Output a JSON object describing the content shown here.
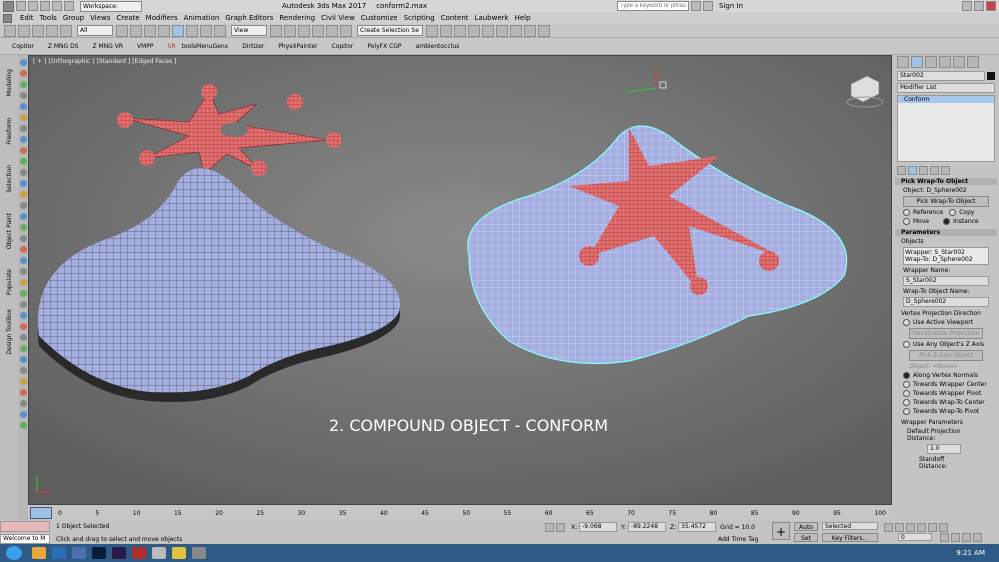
{
  "titlebar": {
    "workspace": "Workspace: Default",
    "app_title": "Autodesk 3ds Max 2017",
    "file_name": "conform2.max",
    "search_placeholder": "Type a keyword or phrase",
    "sign_in": "Sign In"
  },
  "menu": [
    "Edit",
    "Tools",
    "Group",
    "Views",
    "Create",
    "Modifiers",
    "Animation",
    "Graph Editors",
    "Rendering",
    "Civil View",
    "Customize",
    "Scripting",
    "Content",
    "Laubwerk",
    "Help"
  ],
  "toolbar": {
    "filter_value": "All",
    "view_value": "View",
    "selection_set": "Create Selection Se"
  },
  "ribbon_tabs": [
    "Copitor",
    "Z MNG DS",
    "Z MNG VR",
    "VMPP",
    "SR",
    "toolsMenuGenx",
    "Dirtizer",
    "PhysXPainter",
    "Copitor",
    "PolyFX CGP",
    "ambientocclus"
  ],
  "left_tabs": [
    "Modeling",
    "Freeform",
    "Selection",
    "Object Paint",
    "Populate",
    "Design ToolBox"
  ],
  "viewport": {
    "label": "[ + ] [Orthographic ] [Standard ] [Edged Faces ]",
    "caption": "2. COMPOUND OBJECT - CONFORM"
  },
  "panel": {
    "object_name": "Star002",
    "modifier_list": "Modifier List",
    "stack_item": "Conform",
    "pick_rollout": "Pick Wrap-To Object",
    "object_value": "Object: D_Sphere002",
    "pick_btn": "Pick Wrap-To Object",
    "radio_reference": "Reference",
    "radio_copy": "Copy",
    "radio_move": "Move",
    "radio_instance": "Instance",
    "params_rollout": "Parameters",
    "objects_label": "Objects",
    "objects_box_1": "Wrapper: S_Star002",
    "objects_box_2": "Wrap-To: D_Sphere002",
    "wrapper_name_label": "Wrapper Name:",
    "wrapper_name": "S_Star002",
    "wrapto_name_label": "Wrap-To Object Name:",
    "wrapto_name": "D_Sphere002",
    "vpd_label": "Vertex Projection Direction",
    "use_active_viewport": "Use Active Viewport",
    "recalc_btn": "Recalculate Projection",
    "use_any_z": "Use Any Object's Z Axis",
    "pick_z_btn": "Pick Z-Axis Object",
    "object_none": "Object: <None>",
    "along_normals": "Along Vertex Normals",
    "towards_wrapper_center": "Towards Wrapper Center",
    "towards_wrapper_pivot": "Towards Wrapper Pivot",
    "towards_wrapto_center": "Towards Wrap-To Center",
    "towards_wrapto_pivot": "Towards Wrap-To Pivot",
    "wrapper_params": "Wrapper Parameters",
    "default_proj_dist_label": "Default Projection Distance:",
    "default_proj_dist": "1.0",
    "standoff_label": "Standoff Distance:"
  },
  "timeline": {
    "frame_counter": "0 / 100",
    "ticks": [
      "0",
      "5",
      "10",
      "15",
      "20",
      "25",
      "30",
      "35",
      "40",
      "45",
      "50",
      "55",
      "60",
      "65",
      "70",
      "75",
      "80",
      "85",
      "90",
      "95",
      "100"
    ]
  },
  "status": {
    "welcome": "Welcome to M",
    "selected": "1 Object Selected",
    "prompt": "Click and drag to select and move objects",
    "x_label": "X:",
    "x_val": "-9.068",
    "y_label": "Y:",
    "y_val": "-89.2248",
    "z_label": "Z:",
    "z_val": "35.4572",
    "grid": "Grid = 10.0",
    "add_time_tag": "Add Time Tag",
    "auto_key": "Auto Key",
    "set_key": "Set Key",
    "selected_dd": "Selected",
    "key_filters": "Key Filters...",
    "frame_val": "0"
  },
  "taskbar": {
    "time": "9:21 AM"
  }
}
